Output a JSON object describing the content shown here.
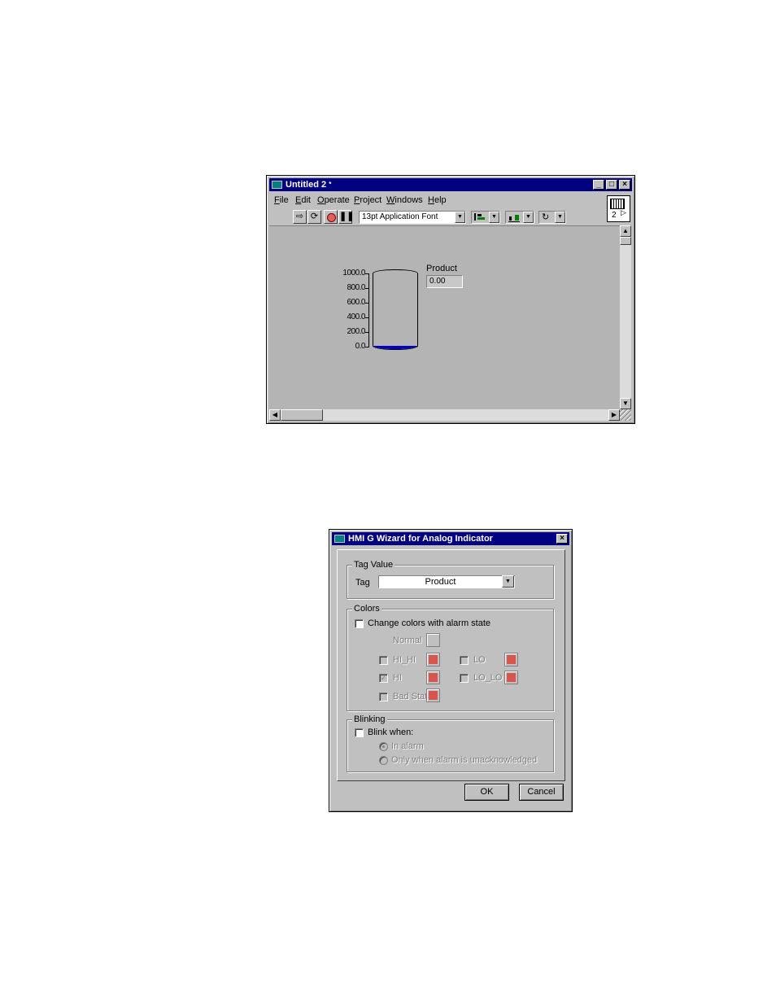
{
  "vi_window": {
    "title": "Untitled 2",
    "title_marker": "*",
    "menu": [
      "File",
      "Edit",
      "Operate",
      "Project",
      "Windows",
      "Help"
    ],
    "font_selector": "13pt Application Font",
    "icon_number": "2",
    "tank": {
      "label": "Product",
      "value": "0.00",
      "scale_ticks": [
        "1000.0",
        "800.0",
        "600.0",
        "400.0",
        "200.0",
        "0.0"
      ],
      "level_fraction": 0
    }
  },
  "wizard": {
    "title": "HMI G Wizard for Analog Indicator",
    "tag_group": {
      "label": "Tag Value",
      "tag_label": "Tag",
      "tag_value": "Product"
    },
    "colors_group": {
      "label": "Colors",
      "change_colors_label": "Change colors with alarm state",
      "normal_label": "Normal",
      "hi_hi_label": "HI_HI",
      "hi_label": "HI",
      "bad_stat_label": "Bad Stat",
      "lo_label": "LO",
      "lo_lo_label": "LO_LO",
      "alarm_color": "#d9534f"
    },
    "blinking_group": {
      "label": "Blinking",
      "blink_when_label": "Blink when:",
      "in_alarm_label": "In alarm",
      "unack_label": "Only when alarm is unacknowledged"
    },
    "ok_label": "OK",
    "cancel_label": "Cancel"
  }
}
